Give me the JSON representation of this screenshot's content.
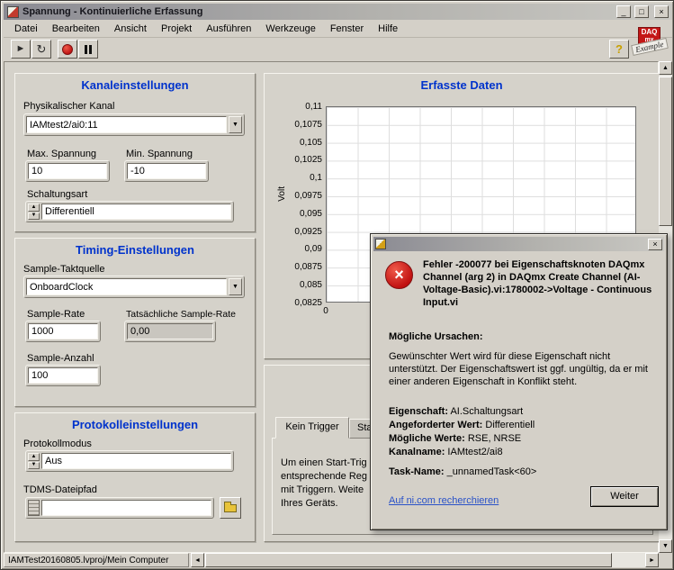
{
  "window": {
    "title": "Spannung - Kontinuierliche Erfassung",
    "menu_items": [
      "Datei",
      "Bearbeiten",
      "Ansicht",
      "Projekt",
      "Ausführen",
      "Werkzeuge",
      "Fenster",
      "Hilfe"
    ],
    "status_tab": "IAMTest20160805.lvproj/Mein Computer"
  },
  "icons": {
    "run": "►",
    "continuous_run": "↻",
    "help": "?",
    "minimize": "_",
    "maximize": "□",
    "close": "×",
    "dropdown": "▼",
    "spin_up": "▲",
    "spin_down": "▼",
    "scroll_up": "▲",
    "scroll_down": "▼",
    "scroll_left": "◄",
    "scroll_right": "►"
  },
  "logo": {
    "daq": "DAQ",
    "mx": "mx",
    "example": "Example"
  },
  "channel_section": {
    "title": "Kanaleinstellungen",
    "physical_channel_label": "Physikalischer Kanal",
    "physical_channel_value": "IAMtest2/ai0:11",
    "max_voltage_label": "Max. Spannung",
    "max_voltage_value": "10",
    "min_voltage_label": "Min. Spannung",
    "min_voltage_value": "-10",
    "terminal_config_label": "Schaltungsart",
    "terminal_config_value": "Differentiell"
  },
  "timing_section": {
    "title": "Timing-Einstellungen",
    "clock_source_label": "Sample-Taktquelle",
    "clock_source_value": "OnboardClock",
    "sample_rate_label": "Sample-Rate",
    "sample_rate_value": "1000",
    "actual_rate_label": "Tatsächliche Sample-Rate",
    "actual_rate_value": "0,00",
    "sample_count_label": "Sample-Anzahl",
    "sample_count_value": "100"
  },
  "logging_section": {
    "title": "Protokolleinstellungen",
    "mode_label": "Protokollmodus",
    "mode_value": "Aus",
    "path_label": "TDMS-Dateipfad",
    "path_value": ""
  },
  "graph": {
    "title": "Erfasste Daten",
    "y_axis_label": "Volt",
    "y_ticks": [
      "0,11",
      "0,1075",
      "0,105",
      "0,1025",
      "0,1",
      "0,0975",
      "0,095",
      "0,0925",
      "0,09",
      "0,0875",
      "0,085",
      "0,0825"
    ],
    "x_tick": "0"
  },
  "trigger_section": {
    "tab_active": "Kein Trigger",
    "tab_partial": "Sta",
    "body_lines": [
      "Um einen Start-Trig",
      "entsprechende Reg",
      "mit Triggern. Weite",
      "Ihres Geräts."
    ]
  },
  "dialog": {
    "error_message": "Fehler -200077 bei Eigenschaftsknoten DAQmx Channel (arg 2) in DAQmx Create Channel (AI-Voltage-Basic).vi:1780002->Voltage - Continuous Input.vi",
    "causes_heading": "Mögliche Ursachen:",
    "cause_text": "Gewünschter Wert wird für diese Eigenschaft nicht unterstützt. Der Eigenschaftswert ist ggf. ungültig, da er mit einer anderen Eigenschaft in Konflikt steht.",
    "property_label": "Eigenschaft:",
    "property_value": "AI.Schaltungsart",
    "requested_label": "Angeforderter Wert:",
    "requested_value": "Differentiell",
    "possible_label": "Mögliche Werte:",
    "possible_value": "RSE, NRSE",
    "channel_label": "Kanalname:",
    "channel_value": "IAMtest2/ai8",
    "task_label": "Task-Name:",
    "task_value": "_unnamedTask<60>",
    "link_text": "Auf ni.com recherchieren",
    "continue_button": "Weiter"
  },
  "colors": {
    "heading_blue": "#0033cc",
    "error_red": "#c01010",
    "link_blue": "#2a52c8",
    "panel_gray": "#d5d2ca",
    "logo_red": "#c41616"
  }
}
